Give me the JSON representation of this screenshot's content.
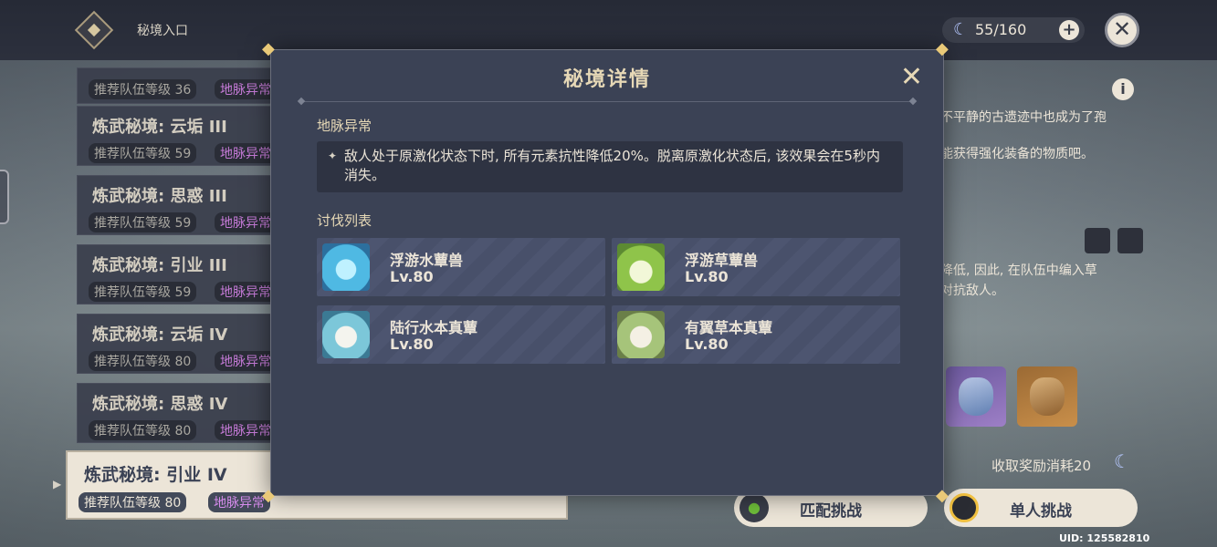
{
  "top_bar": {
    "title": "秘境入口",
    "resin": "55/160",
    "resin_icon": "moon-icon",
    "add_icon": "plus-icon",
    "close_icon": "close-icon"
  },
  "domain_list": [
    {
      "name": "",
      "level": "推荐队伍等级 36",
      "anomaly": "地脉异常"
    },
    {
      "name": "炼武秘境: 云垢 III",
      "level": "推荐队伍等级 59",
      "anomaly": "地脉异常"
    },
    {
      "name": "炼武秘境: 思惑 III",
      "level": "推荐队伍等级 59",
      "anomaly": "地脉异常"
    },
    {
      "name": "炼武秘境: 引业 III",
      "level": "推荐队伍等级 59",
      "anomaly": "地脉异常"
    },
    {
      "name": "炼武秘境: 云垢 IV",
      "level": "推荐队伍等级 80",
      "anomaly": "地脉异常"
    },
    {
      "name": "炼武秘境: 思惑 IV",
      "level": "推荐队伍等级 80",
      "anomaly": "地脉异常"
    },
    {
      "name": "炼武秘境: 引业 IV",
      "level": "推荐队伍等级 80",
      "anomaly": "地脉异常",
      "selected": true
    }
  ],
  "right_panel": {
    "desc_line1": "不平静的古遗迹中也成为了孢",
    "desc_line2": "能获得强化装备的物质吧。",
    "desc_line3": "降低, 因此, 在队伍中编入草",
    "desc_line4": "对抗敌人。",
    "cost_text": "收取奖励消耗20",
    "match_button": "匹配挑战",
    "solo_button": "单人挑战",
    "uid": "UID: 125582810"
  },
  "modal": {
    "title": "秘境详情",
    "anomaly_label": "地脉异常",
    "anomaly_text": "敌人处于原激化状态下时, 所有元素抗性降低20%。脱离原激化状态后, 该效果会在5秒内消失。",
    "enemy_label": "讨伐列表",
    "enemies": [
      {
        "name": "浮游水蕈兽",
        "level": "Lv.80"
      },
      {
        "name": "浮游草蕈兽",
        "level": "Lv.80"
      },
      {
        "name": "陆行水本真蕈",
        "level": "Lv.80"
      },
      {
        "name": "有翼草本真蕈",
        "level": "Lv.80"
      }
    ]
  }
}
